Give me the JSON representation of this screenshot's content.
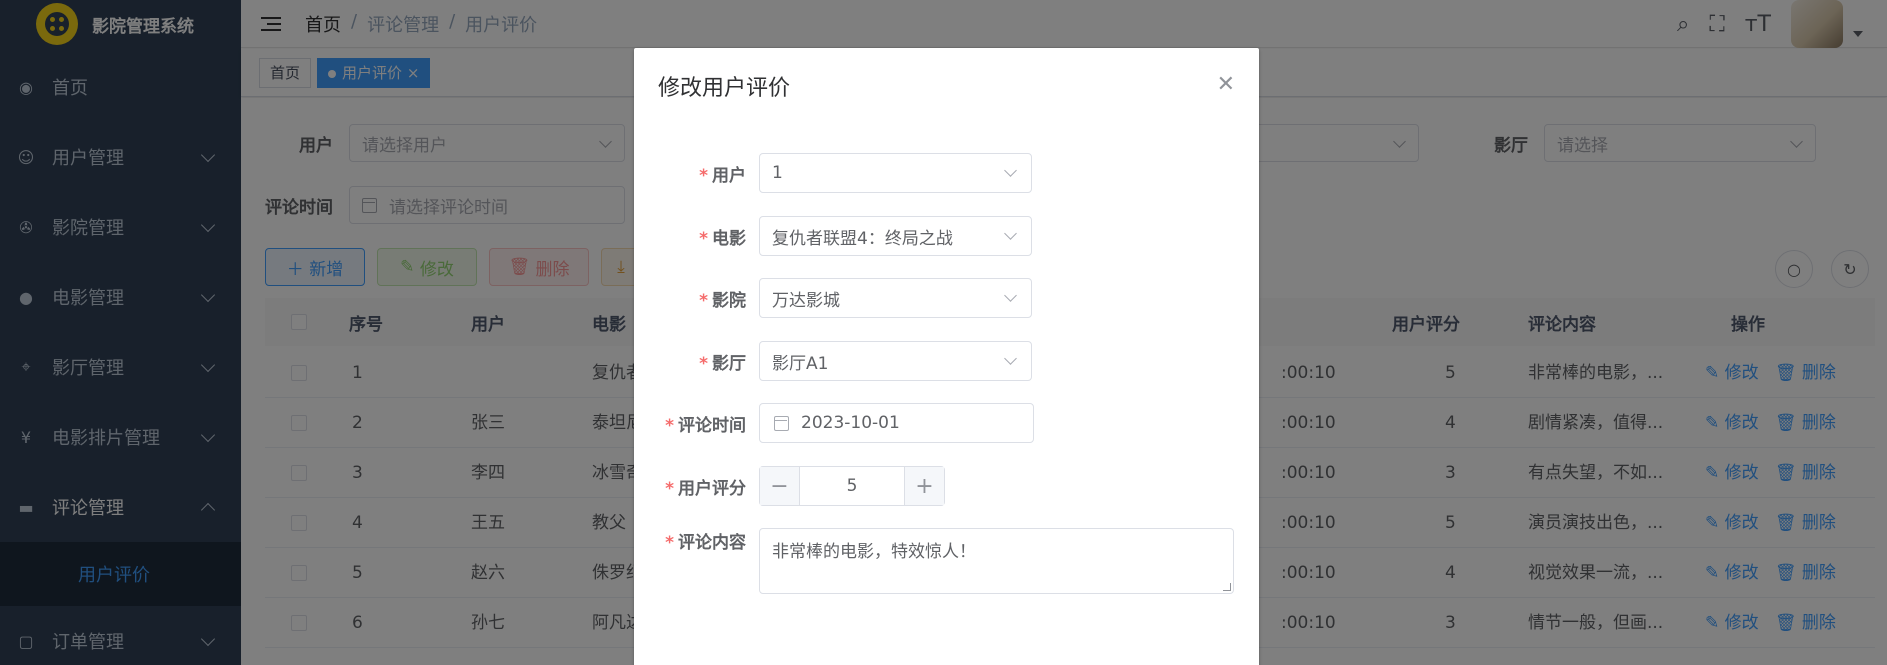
{
  "app": {
    "title": "影院管理系统"
  },
  "sidebar": {
    "items": [
      {
        "label": "首页",
        "icon": "dashboard-icon"
      },
      {
        "label": "用户管理",
        "icon": "user-icon"
      },
      {
        "label": "影院管理",
        "icon": "cinema-icon"
      },
      {
        "label": "电影管理",
        "icon": "github-icon"
      },
      {
        "label": "影厅管理",
        "icon": "location-icon"
      },
      {
        "label": "电影排片管理",
        "icon": "yen-icon"
      },
      {
        "label": "评论管理",
        "icon": "message-icon"
      },
      {
        "label": "订单管理",
        "icon": "clipboard-icon"
      }
    ],
    "sub_item": "用户评价"
  },
  "breadcrumb": [
    "首页",
    "评论管理",
    "用户评价"
  ],
  "tags": [
    "首页",
    "用户评价"
  ],
  "search": {
    "user_label": "用户",
    "user_placeholder": "请选择用户",
    "hall_label": "影厅",
    "hall_placeholder": "请选择",
    "time_label": "评论时间",
    "time_placeholder": "请选择评论时间"
  },
  "toolbar": {
    "add": "新增",
    "edit": "修改",
    "delete": "删除"
  },
  "table": {
    "headers": [
      "序号",
      "用户",
      "电影",
      "用户评分",
      "评论内容",
      "操作"
    ],
    "rows": [
      {
        "no": "1",
        "user": "",
        "movie": "复仇者",
        "time": ":00:10",
        "score": "5",
        "content": "非常棒的电影，..."
      },
      {
        "no": "2",
        "user": "张三",
        "movie": "泰坦尼",
        "time": ":00:10",
        "score": "4",
        "content": "剧情紧凑，值得..."
      },
      {
        "no": "3",
        "user": "李四",
        "movie": "冰雪奇",
        "time": ":00:10",
        "score": "3",
        "content": "有点失望，不如..."
      },
      {
        "no": "4",
        "user": "王五",
        "movie": "教父",
        "time": ":00:10",
        "score": "5",
        "content": "演员演技出色，..."
      },
      {
        "no": "5",
        "user": "赵六",
        "movie": "侏罗纪",
        "time": ":00:10",
        "score": "4",
        "content": "视觉效果一流，..."
      },
      {
        "no": "6",
        "user": "孙七",
        "movie": "阿凡达",
        "time": ":00:10",
        "score": "3",
        "content": "情节一般，但画..."
      }
    ],
    "op_edit": "修改",
    "op_delete": "删除"
  },
  "dialog": {
    "title": "修改用户评价",
    "user_label": "用户",
    "user_value": "1",
    "movie_label": "电影",
    "movie_value": "复仇者联盟4：终局之战",
    "cinema_label": "影院",
    "cinema_value": "万达影城",
    "hall_label": "影厅",
    "hall_value": "影厅A1",
    "time_label": "评论时间",
    "time_value": "2023-10-01",
    "score_label": "用户评分",
    "score_value": "5",
    "content_label": "评论内容",
    "content_value": "非常棒的电影，特效惊人！"
  },
  "colors": {
    "primary": "#409eff",
    "success": "#67c23a",
    "danger": "#f56c6c",
    "warning": "#e6a23c",
    "sidebar": "#304156"
  }
}
